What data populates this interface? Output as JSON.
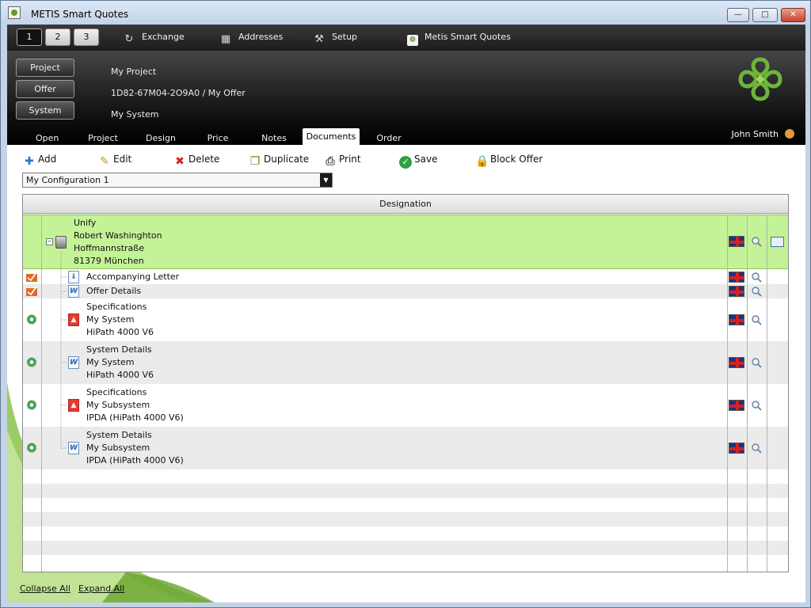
{
  "window": {
    "title": "METIS Smart Quotes"
  },
  "topnav": {
    "pages": [
      "1",
      "2",
      "3"
    ],
    "links": [
      {
        "label": "Exchange",
        "icon": "exchange-icon"
      },
      {
        "label": "Addresses",
        "icon": "addresses-icon"
      },
      {
        "label": "Setup",
        "icon": "setup-icon"
      },
      {
        "label": "Metis Smart Quotes",
        "icon": "app-icon"
      }
    ]
  },
  "header": {
    "buttons": [
      "Project",
      "Offer",
      "System"
    ],
    "values": [
      "My Project",
      "1D82-67M04-2O9A0 / My Offer",
      "My System"
    ],
    "user": "John Smith",
    "accent": "#7cc242"
  },
  "tabs": [
    "Open",
    "Project",
    "Design",
    "Price",
    "Notes",
    "Documents",
    "Order"
  ],
  "active_tab": "Documents",
  "toolbar": {
    "add": "Add",
    "edit": "Edit",
    "delete": "Delete",
    "duplicate": "Duplicate",
    "print": "Print",
    "save": "Save",
    "block_offer": "Block Offer"
  },
  "configuration": {
    "selected": "My Configuration 1"
  },
  "grid": {
    "header": "Designation",
    "root": {
      "lines": [
        "Unify",
        "Robert Washinghton",
        "Hoffmannstraße",
        "81379 München"
      ]
    },
    "rows": [
      {
        "lines": [
          "Accompanying Letter"
        ],
        "doc": "letter"
      },
      {
        "lines": [
          "Offer Details"
        ],
        "doc": "word"
      },
      {
        "lines": [
          "Specifications",
          "My System",
          "HiPath 4000 V6"
        ],
        "doc": "pdf"
      },
      {
        "lines": [
          "System Details",
          "My System",
          "HiPath 4000 V6"
        ],
        "doc": "word"
      },
      {
        "lines": [
          "Specifications",
          "My Subsystem",
          "IPDA (HiPath 4000 V6)"
        ],
        "doc": "pdf"
      },
      {
        "lines": [
          "System Details",
          "My Subsystem",
          "IPDA (HiPath 4000 V6)"
        ],
        "doc": "word"
      }
    ]
  },
  "footer": {
    "collapse_all": "Collapse All",
    "expand_all": "Expand All"
  }
}
